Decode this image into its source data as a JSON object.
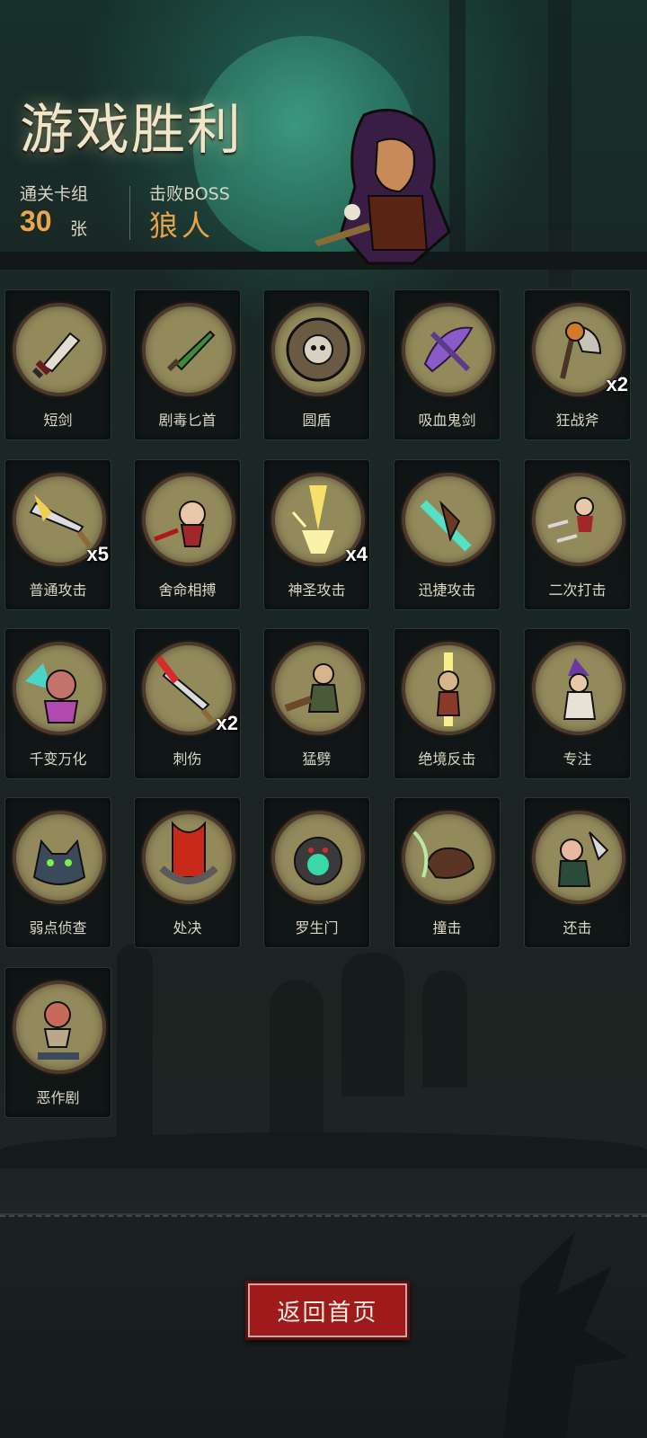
{
  "header": {
    "title": "游戏胜利",
    "cleared_deck_label": "通关卡组",
    "cleared_deck_count": "30",
    "cleared_deck_unit": "张",
    "defeated_boss_label": "击败BOSS",
    "defeated_boss_name": "狼人"
  },
  "cards": [
    {
      "name": "短剑",
      "count": "",
      "icon": "short-sword-icon"
    },
    {
      "name": "剧毒匕首",
      "count": "",
      "icon": "poison-dagger-icon"
    },
    {
      "name": "圆盾",
      "count": "",
      "icon": "round-shield-icon"
    },
    {
      "name": "吸血鬼剑",
      "count": "",
      "icon": "vampire-sword-icon"
    },
    {
      "name": "狂战斧",
      "count": "x2",
      "icon": "berserker-axe-icon"
    },
    {
      "name": "普通攻击",
      "count": "x5",
      "icon": "normal-attack-icon"
    },
    {
      "name": "舍命相搏",
      "count": "",
      "icon": "desperate-fight-icon"
    },
    {
      "name": "神圣攻击",
      "count": "x4",
      "icon": "holy-attack-icon"
    },
    {
      "name": "迅捷攻击",
      "count": "",
      "icon": "swift-attack-icon"
    },
    {
      "name": "二次打击",
      "count": "",
      "icon": "double-strike-icon"
    },
    {
      "name": "千变万化",
      "count": "",
      "icon": "shapeshift-icon"
    },
    {
      "name": "刺伤",
      "count": "x2",
      "icon": "stab-icon"
    },
    {
      "name": "猛劈",
      "count": "",
      "icon": "cleave-icon"
    },
    {
      "name": "绝境反击",
      "count": "",
      "icon": "last-stand-counter-icon"
    },
    {
      "name": "专注",
      "count": "",
      "icon": "focus-icon"
    },
    {
      "name": "弱点侦查",
      "count": "",
      "icon": "weakness-scout-icon"
    },
    {
      "name": "处决",
      "count": "",
      "icon": "execute-icon"
    },
    {
      "name": "罗生门",
      "count": "",
      "icon": "rashomon-gate-icon"
    },
    {
      "name": "撞击",
      "count": "",
      "icon": "charge-icon"
    },
    {
      "name": "还击",
      "count": "",
      "icon": "riposte-icon"
    },
    {
      "name": "恶作剧",
      "count": "",
      "icon": "prank-icon"
    }
  ],
  "footer": {
    "home_button_label": "返回首页"
  },
  "colors": {
    "accent_orange": "#e6a34a",
    "button_red": "#9f1b1b",
    "disc_bg": "#938a5b"
  }
}
